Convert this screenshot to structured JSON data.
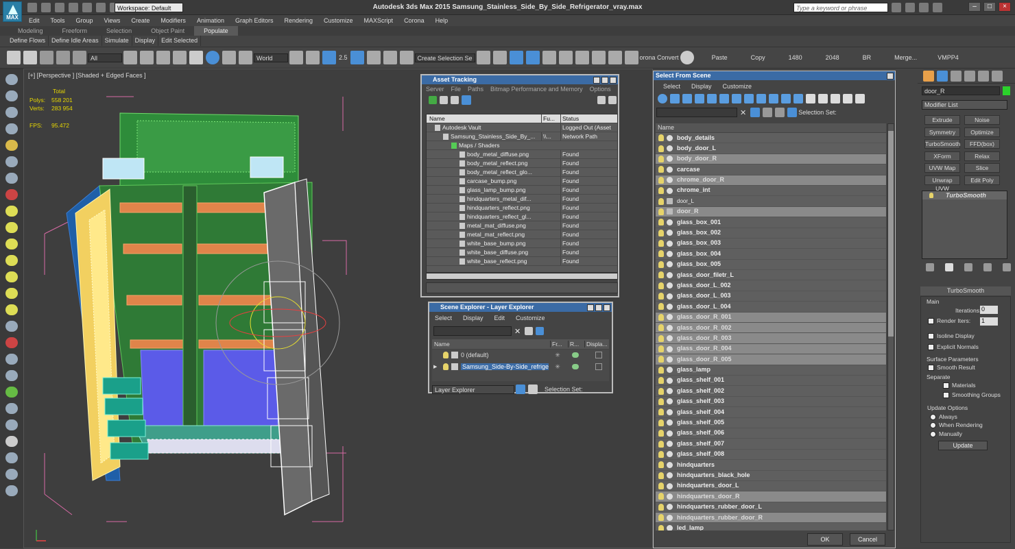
{
  "title": {
    "app": "Autodesk 3ds Max  2015     Samsung_Stainless_Side_By_Side_Refrigerator_vray.max",
    "workspace": "Workspace: Default",
    "search_placeholder": "Type a keyword or phrase",
    "logo_label": "MAX"
  },
  "menu": [
    "Edit",
    "Tools",
    "Group",
    "Views",
    "Create",
    "Modifiers",
    "Animation",
    "Graph Editors",
    "Rendering",
    "Customize",
    "MAXScript",
    "Corona",
    "Help"
  ],
  "ribbon_tabs": [
    "Modeling",
    "Freeform",
    "Selection",
    "Object Paint",
    "Populate"
  ],
  "ribbon_subtabs": [
    "Define Flows",
    "Define Idle Areas",
    "Simulate",
    "Display",
    "Edit Selected"
  ],
  "toolbar": {
    "filter": "All",
    "coord": "World",
    "snap_value": "2.5",
    "selection_set": "Create Selection Se",
    "corona_convert": "orona Convert",
    "paste": "Paste",
    "copy": "Copy",
    "val1": "1480",
    "val2": "2048",
    "br": "BR",
    "merge": "Merge...",
    "vmpp": "VMPP4"
  },
  "viewport": {
    "label": "[+] [Perspective ] [Shaded + Edged Faces ]",
    "stats": {
      "total_label": "Total",
      "polys_label": "Polys:",
      "polys": "558 201",
      "verts_label": "Verts:",
      "verts": "283 954",
      "fps_label": "FPS:",
      "fps": "95.472"
    }
  },
  "asset_tracking": {
    "title": "Asset Tracking",
    "menu": [
      "Server",
      "File",
      "Paths",
      "Bitmap Performance and Memory",
      "Options"
    ],
    "columns": [
      "Name",
      "Fu...",
      "Status"
    ],
    "rows": [
      {
        "name": "Autodesk Vault",
        "full": "",
        "status": "Logged Out (Asset T",
        "indent": 1
      },
      {
        "name": "Samsung_Stainless_Side_By_...",
        "full": "\\\\...",
        "status": "Network Path",
        "indent": 2
      },
      {
        "name": "Maps / Shaders",
        "full": "",
        "status": "",
        "indent": 3
      },
      {
        "name": "body_metal_diffuse.png",
        "full": "",
        "status": "Found",
        "indent": 4
      },
      {
        "name": "body_metal_reflect.png",
        "full": "",
        "status": "Found",
        "indent": 4
      },
      {
        "name": "body_metal_reflect_glo...",
        "full": "",
        "status": "Found",
        "indent": 4
      },
      {
        "name": "carcase_bump.png",
        "full": "",
        "status": "Found",
        "indent": 4
      },
      {
        "name": "glass_lamp_bump.png",
        "full": "",
        "status": "Found",
        "indent": 4
      },
      {
        "name": "hindquarters_metal_dif...",
        "full": "",
        "status": "Found",
        "indent": 4
      },
      {
        "name": "hindquarters_reflect.png",
        "full": "",
        "status": "Found",
        "indent": 4
      },
      {
        "name": "hindquarters_reflect_gl...",
        "full": "",
        "status": "Found",
        "indent": 4
      },
      {
        "name": "metal_mat_diffuse.png",
        "full": "",
        "status": "Found",
        "indent": 4
      },
      {
        "name": "metal_mat_reflect.png",
        "full": "",
        "status": "Found",
        "indent": 4
      },
      {
        "name": "white_base_bump.png",
        "full": "",
        "status": "Found",
        "indent": 4
      },
      {
        "name": "white_base_diffuse.png",
        "full": "",
        "status": "Found",
        "indent": 4
      },
      {
        "name": "white_base_reflect.png",
        "full": "",
        "status": "Found",
        "indent": 4
      }
    ]
  },
  "scene_explorer": {
    "title": "Scene Explorer - Layer Explorer",
    "menu": [
      "Select",
      "Display",
      "Edit",
      "Customize"
    ],
    "columns": [
      "Name",
      "Fr...",
      "R...",
      "Displa..."
    ],
    "rows": [
      {
        "name": "0 (default)",
        "selected": false
      },
      {
        "name": "Samsung_Side-By-Side_refriger...",
        "selected": true
      }
    ],
    "footer_dropdown": "Layer Explorer",
    "selection_set": "Selection Set:"
  },
  "select_from_scene": {
    "title": "Select From Scene",
    "menu": [
      "Select",
      "Display",
      "Customize"
    ],
    "selection_set": "Selection Set:",
    "column": "Name",
    "items": [
      {
        "name": "body_details",
        "sel": false,
        "thin": false
      },
      {
        "name": "body_door_L",
        "sel": false,
        "thin": false
      },
      {
        "name": "body_door_R",
        "sel": true,
        "thin": false
      },
      {
        "name": "carcase",
        "sel": false,
        "thin": false
      },
      {
        "name": "chrome_door_R",
        "sel": true,
        "thin": false
      },
      {
        "name": "chrome_int",
        "sel": false,
        "thin": false
      },
      {
        "name": "door_L",
        "sel": false,
        "thin": true
      },
      {
        "name": "door_R",
        "sel": true,
        "thin": false
      },
      {
        "name": "glass_box_001",
        "sel": false,
        "thin": false
      },
      {
        "name": "glass_box_002",
        "sel": false,
        "thin": false
      },
      {
        "name": "glass_box_003",
        "sel": false,
        "thin": false
      },
      {
        "name": "glass_box_004",
        "sel": false,
        "thin": false
      },
      {
        "name": "glass_box_005",
        "sel": false,
        "thin": false
      },
      {
        "name": "glass_door_filetr_L",
        "sel": false,
        "thin": false
      },
      {
        "name": "glass_door_L_002",
        "sel": false,
        "thin": false
      },
      {
        "name": "glass_door_L_003",
        "sel": false,
        "thin": false
      },
      {
        "name": "glass_door_L_004",
        "sel": false,
        "thin": false
      },
      {
        "name": "glass_door_R_001",
        "sel": true,
        "thin": false
      },
      {
        "name": "glass_door_R_002",
        "sel": true,
        "thin": false
      },
      {
        "name": "glass_door_R_003",
        "sel": true,
        "thin": false
      },
      {
        "name": "glass_door_R_004",
        "sel": true,
        "thin": false
      },
      {
        "name": "glass_door_R_005",
        "sel": true,
        "thin": false
      },
      {
        "name": "glass_lamp",
        "sel": false,
        "thin": false
      },
      {
        "name": "glass_shelf_001",
        "sel": false,
        "thin": false
      },
      {
        "name": "glass_shelf_002",
        "sel": false,
        "thin": false
      },
      {
        "name": "glass_shelf_003",
        "sel": false,
        "thin": false
      },
      {
        "name": "glass_shelf_004",
        "sel": false,
        "thin": false
      },
      {
        "name": "glass_shelf_005",
        "sel": false,
        "thin": false
      },
      {
        "name": "glass_shelf_006",
        "sel": false,
        "thin": false
      },
      {
        "name": "glass_shelf_007",
        "sel": false,
        "thin": false
      },
      {
        "name": "glass_shelf_008",
        "sel": false,
        "thin": false
      },
      {
        "name": "hindquarters",
        "sel": false,
        "thin": false
      },
      {
        "name": "hindquarters_black_hole",
        "sel": false,
        "thin": false
      },
      {
        "name": "hindquarters_door_L",
        "sel": false,
        "thin": false
      },
      {
        "name": "hindquarters_door_R",
        "sel": true,
        "thin": false
      },
      {
        "name": "hindquarters_rubber_door_L",
        "sel": false,
        "thin": false
      },
      {
        "name": "hindquarters_rubber_door_R",
        "sel": true,
        "thin": false
      },
      {
        "name": "led_lamp",
        "sel": false,
        "thin": false
      }
    ],
    "ok": "OK",
    "cancel": "Cancel"
  },
  "command_panel": {
    "object_name": "door_R",
    "modifier_list": "Modifier List",
    "buttons": [
      "Extrude",
      "Noise",
      "Symmetry",
      "Optimize",
      "TurboSmooth",
      "FFD(box)",
      "XForm",
      "Relax",
      "UVW Map",
      "Slice",
      "Unwrap UVW",
      "Edit Poly"
    ],
    "stack_item": "TurboSmooth",
    "rollout_title": "TurboSmooth",
    "main_group": "Main",
    "iterations_label": "Iterations:",
    "iterations": "0",
    "render_iters_label": "Render Iters:",
    "render_iters": "1",
    "isoline": "Isoline Display",
    "explicit_normals": "Explicit Normals",
    "surface_params": "Surface Parameters",
    "smooth_result": "Smooth Result",
    "separate": "Separate",
    "materials": "Materials",
    "smoothing_groups": "Smoothing Groups",
    "update_options": "Update Options",
    "always": "Always",
    "when_rendering": "When Rendering",
    "manually": "Manually",
    "update": "Update"
  }
}
